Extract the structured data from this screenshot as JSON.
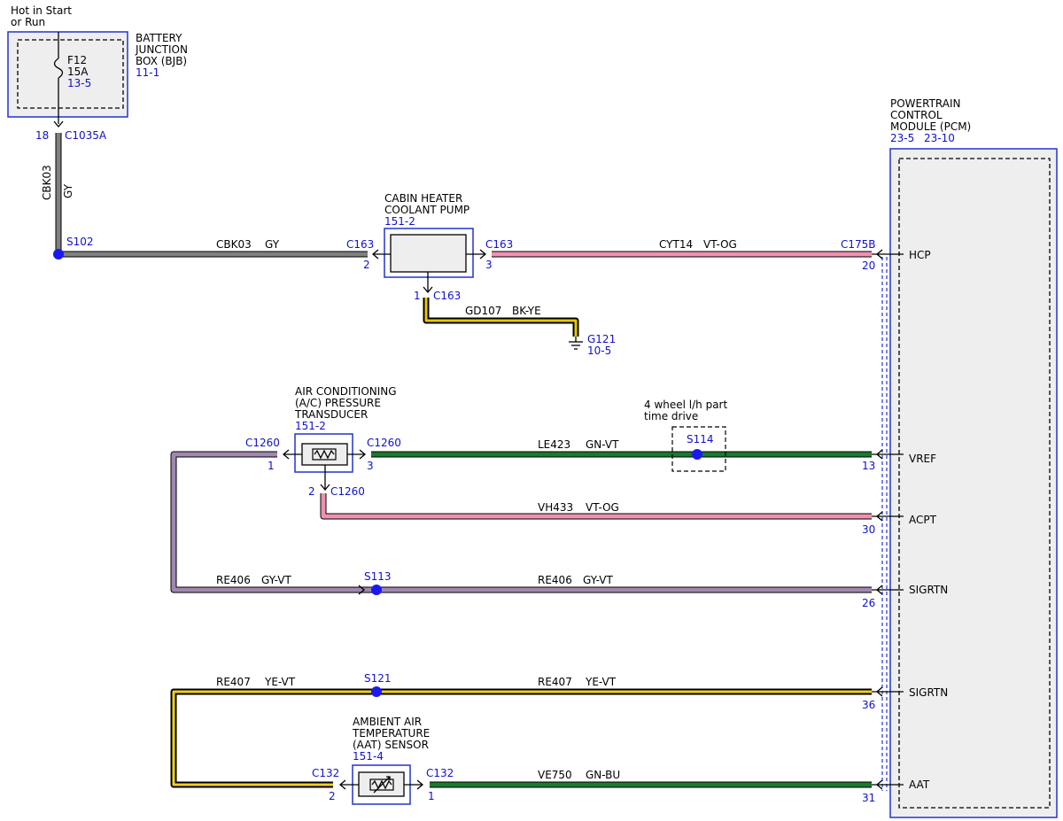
{
  "colors": {
    "ref_text": "#1111cc",
    "component_outline": "#2233cc",
    "wire_gray": "#808080",
    "wire_pink": "#f090b0",
    "wire_green": "#1a7a2e",
    "wire_purple": "#a088b0",
    "wire_yellow": "#f0d020",
    "splice": "#1a1aee"
  },
  "power_source": {
    "label_line1": "Hot in Start",
    "label_line2": "or Run"
  },
  "bjb": {
    "name_line1": "BATTERY",
    "name_line2": "JUNCTION",
    "name_line3": "BOX (BJB)",
    "ref": "11-1",
    "fuse_name": "F12",
    "fuse_rating": "15A",
    "fuse_ref": "13-5",
    "pin": "18",
    "connector": "C1035A"
  },
  "pcm": {
    "name_line1": "POWERTRAIN",
    "name_line2": "CONTROL",
    "name_line3": "MODULE (PCM)",
    "ref1": "23-5",
    "ref2": "23-10",
    "connector": "C175B",
    "pins": [
      {
        "pin": "20",
        "signal": "HCP"
      },
      {
        "pin": "13",
        "signal": "VREF"
      },
      {
        "pin": "30",
        "signal": "ACPT"
      },
      {
        "pin": "26",
        "signal": "SIGRTN"
      },
      {
        "pin": "36",
        "signal": "SIGRTN"
      },
      {
        "pin": "31",
        "signal": "AAT"
      }
    ]
  },
  "pump": {
    "name_line1": "CABIN HEATER",
    "name_line2": "COOLANT PUMP",
    "ref": "151-2",
    "connector": "C163",
    "pin_left": "2",
    "pin_right": "3",
    "pin_bottom": "1"
  },
  "ac_transducer": {
    "name_line1": "AIR CONDITIONING",
    "name_line2": "(A/C) PRESSURE",
    "name_line3": "TRANSDUCER",
    "ref": "151-2",
    "connector": "C1260",
    "pin_left": "1",
    "pin_right": "3",
    "pin_bottom": "2"
  },
  "aat_sensor": {
    "name_line1": "AMBIENT AIR",
    "name_line2": "TEMPERATURE",
    "name_line3": "(AAT) SENSOR",
    "ref": "151-4",
    "connector": "C132",
    "pin_left": "2",
    "pin_right": "1"
  },
  "ground": {
    "name": "G121",
    "ref": "10-5"
  },
  "option_box": {
    "label_line1": "4 wheel l/h part",
    "label_line2": "time drive",
    "splice": "S114"
  },
  "splices": {
    "s102": "S102",
    "s113": "S113",
    "s121": "S121"
  },
  "wires": {
    "cbk03_vertical": {
      "circuit": "CBK03",
      "color": "GY"
    },
    "cbk03": {
      "circuit": "CBK03",
      "color": "GY"
    },
    "cyt14": {
      "circuit": "CYT14",
      "color": "VT-OG"
    },
    "gd107": {
      "circuit": "GD107",
      "color": "BK-YE"
    },
    "le423": {
      "circuit": "LE423",
      "color": "GN-VT"
    },
    "vh433": {
      "circuit": "VH433",
      "color": "VT-OG"
    },
    "re406_left": {
      "circuit": "RE406",
      "color": "GY-VT"
    },
    "re406_right": {
      "circuit": "RE406",
      "color": "GY-VT"
    },
    "re407_left": {
      "circuit": "RE407",
      "color": "YE-VT"
    },
    "re407_right": {
      "circuit": "RE407",
      "color": "YE-VT"
    },
    "ve750": {
      "circuit": "VE750",
      "color": "GN-BU"
    }
  }
}
